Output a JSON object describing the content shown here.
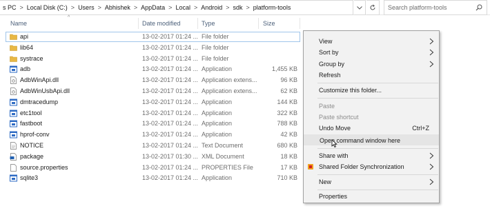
{
  "address": {
    "crumbs": [
      "s PC",
      "Local Disk (C:)",
      "Users",
      "Abhishek",
      "AppData",
      "Local",
      "Android",
      "sdk",
      "platform-tools"
    ],
    "separator": ">",
    "search_placeholder": "Search platform-tools"
  },
  "columns": {
    "name": "Name",
    "date": "Date modified",
    "type": "Type",
    "size": "Size"
  },
  "files": [
    {
      "name": "api",
      "date": "13-02-2017 01:24 ...",
      "type": "File folder",
      "size": "",
      "icon": "folder-icon"
    },
    {
      "name": "lib64",
      "date": "13-02-2017 01:24 ...",
      "type": "File folder",
      "size": "",
      "icon": "folder-icon"
    },
    {
      "name": "systrace",
      "date": "13-02-2017 01:24 ...",
      "type": "File folder",
      "size": "",
      "icon": "folder-icon"
    },
    {
      "name": "adb",
      "date": "13-02-2017 01:24 ...",
      "type": "Application",
      "size": "1,455 KB",
      "icon": "application-icon"
    },
    {
      "name": "AdbWinApi.dll",
      "date": "13-02-2017 01:24 ...",
      "type": "Application extens...",
      "size": "96 KB",
      "icon": "dll-icon"
    },
    {
      "name": "AdbWinUsbApi.dll",
      "date": "13-02-2017 01:24 ...",
      "type": "Application extens...",
      "size": "62 KB",
      "icon": "dll-icon"
    },
    {
      "name": "dmtracedump",
      "date": "13-02-2017 01:24 ...",
      "type": "Application",
      "size": "144 KB",
      "icon": "application-icon"
    },
    {
      "name": "etc1tool",
      "date": "13-02-2017 01:24 ...",
      "type": "Application",
      "size": "322 KB",
      "icon": "application-icon"
    },
    {
      "name": "fastboot",
      "date": "13-02-2017 01:24 ...",
      "type": "Application",
      "size": "788 KB",
      "icon": "application-icon"
    },
    {
      "name": "hprof-conv",
      "date": "13-02-2017 01:24 ...",
      "type": "Application",
      "size": "42 KB",
      "icon": "application-icon"
    },
    {
      "name": "NOTICE",
      "date": "13-02-2017 01:24 ...",
      "type": "Text Document",
      "size": "680 KB",
      "icon": "text-file-icon"
    },
    {
      "name": "package",
      "date": "13-02-2017 01:30 ...",
      "type": "XML Document",
      "size": "18 KB",
      "icon": "xml-file-icon"
    },
    {
      "name": "source.properties",
      "date": "13-02-2017 01:24 ...",
      "type": "PROPERTIES File",
      "size": "17 KB",
      "icon": "properties-file-icon"
    },
    {
      "name": "sqlite3",
      "date": "13-02-2017 01:24 ...",
      "type": "Application",
      "size": "710 KB",
      "icon": "application-icon"
    }
  ],
  "context_menu": {
    "view": "View",
    "sort_by": "Sort by",
    "group_by": "Group by",
    "refresh": "Refresh",
    "customize": "Customize this folder...",
    "paste": "Paste",
    "paste_shortcut": "Paste shortcut",
    "undo_move": "Undo Move",
    "undo_shortcut": "Ctrl+Z",
    "open_command": "Open command window here",
    "share_with": "Share with",
    "shared_folder_sync": "Shared Folder Synchronization",
    "new": "New",
    "properties": "Properties"
  },
  "colors": {
    "folder": "#e8b845",
    "app_icon": "#2e6bc4",
    "header_text": "#4c607a",
    "selection_border": "#9fc5ea"
  }
}
